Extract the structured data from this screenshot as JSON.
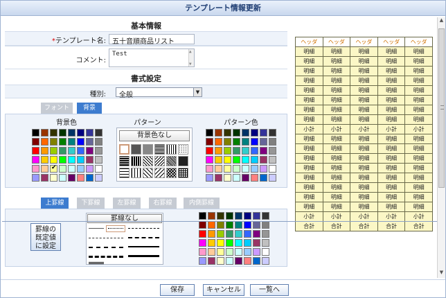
{
  "window": {
    "title": "テンプレート情報更新"
  },
  "basic": {
    "title": "基本情報",
    "name_label": "テンプレート名:",
    "name_required": "*",
    "name_value": "五十音順商品リスト",
    "comment_label": "コメント:",
    "comment_value": "Test"
  },
  "format": {
    "title": "書式設定",
    "type_label": "種別:",
    "type_value": "全般",
    "tabs": [
      {
        "label": "フォント"
      },
      {
        "label": "背景"
      }
    ],
    "bg_color_label": "背景色",
    "pattern_label": "パターン",
    "pattern_color_label": "パターン色",
    "no_bg_label": "背景色なし",
    "border_tabs": [
      {
        "label": "上罫線"
      },
      {
        "label": "下罫線"
      },
      {
        "label": "左罫線"
      },
      {
        "label": "右罫線"
      },
      {
        "label": "内側罫線"
      }
    ],
    "default_border_button": "罫線の\n既定値\nに設定",
    "no_border_label": "罫線なし"
  },
  "palette": [
    "#000000",
    "#993300",
    "#333300",
    "#003300",
    "#003366",
    "#000080",
    "#333399",
    "#333333",
    "#800000",
    "#ff6600",
    "#808000",
    "#008000",
    "#008080",
    "#0000ff",
    "#666699",
    "#808080",
    "#ff0000",
    "#ff9900",
    "#99cc00",
    "#339966",
    "#33cccc",
    "#3366ff",
    "#800080",
    "#969696",
    "#ff00ff",
    "#ffcc00",
    "#ffff00",
    "#00ff00",
    "#00ffff",
    "#00ccff",
    "#993366",
    "#c0c0c0",
    "#ff99cc",
    "#ffcc99",
    "#ffff99",
    "#ccffcc",
    "#ccffff",
    "#99ccff",
    "#cc99ff",
    "#ffffff",
    "#9999ff",
    "#993366",
    "#ffffcc",
    "#ccffff",
    "#660066",
    "#ff8080",
    "#0066cc",
    "#ccccff"
  ],
  "preview": {
    "header": [
      "ヘッダ",
      "ヘッダ",
      "ヘッダ",
      "ヘッダ",
      "ヘッダ"
    ],
    "rows": [
      [
        "明細",
        "明細",
        "明細",
        "明細",
        "明細"
      ],
      [
        "明細",
        "明細",
        "明細",
        "明細",
        "明細"
      ],
      [
        "明細",
        "明細",
        "明細",
        "明細",
        "明細"
      ],
      [
        "明細",
        "明細",
        "明細",
        "明細",
        "明細"
      ],
      [
        "明細",
        "明細",
        "明細",
        "明細",
        "明細"
      ],
      [
        "明細",
        "明細",
        "明細",
        "明細",
        "明細"
      ],
      [
        "明細",
        "明細",
        "明細",
        "明細",
        "明細"
      ],
      [
        "明細",
        "明細",
        "明細",
        "明細",
        "明細"
      ],
      [
        "小計",
        "小計",
        "小計",
        "小計",
        "小計"
      ],
      [
        "明細",
        "明細",
        "明細",
        "明細",
        "明細"
      ],
      [
        "明細",
        "明細",
        "明細",
        "明細",
        "明細"
      ],
      [
        "明細",
        "明細",
        "明細",
        "明細",
        "明細"
      ],
      [
        "明細",
        "明細",
        "明細",
        "明細",
        "明細"
      ],
      [
        "明細",
        "明細",
        "明細",
        "明細",
        "明細"
      ],
      [
        "明細",
        "明細",
        "明細",
        "明細",
        "明細"
      ],
      [
        "明細",
        "明細",
        "明細",
        "明細",
        "明細"
      ],
      [
        "明細",
        "明細",
        "明細",
        "明細",
        "明細"
      ],
      [
        "小計",
        "小計",
        "小計",
        "小計",
        "小計"
      ],
      [
        "合計",
        "合計",
        "合計",
        "合計",
        "合計"
      ]
    ]
  },
  "footer": {
    "save": "保存",
    "cancel": "キャンセル",
    "back": "一覧へ"
  }
}
